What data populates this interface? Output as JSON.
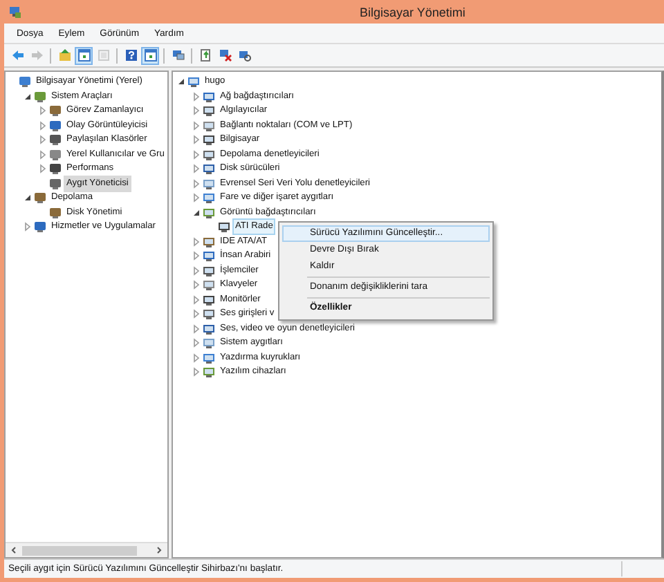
{
  "window": {
    "title": "Bilgisayar Yönetimi"
  },
  "menu": [
    "Dosya",
    "Eylem",
    "Görünüm",
    "Yardım"
  ],
  "toolbar": [
    {
      "kind": "back",
      "pressed": false,
      "disabled": false
    },
    {
      "kind": "forward",
      "pressed": false,
      "disabled": true
    },
    {
      "kind": "separator"
    },
    {
      "kind": "up",
      "pressed": false,
      "disabled": false
    },
    {
      "kind": "tree",
      "pressed": true,
      "disabled": false
    },
    {
      "kind": "export",
      "pressed": false,
      "disabled": true
    },
    {
      "kind": "separator"
    },
    {
      "kind": "help",
      "pressed": false,
      "disabled": false
    },
    {
      "kind": "pane",
      "pressed": true,
      "disabled": false
    },
    {
      "kind": "separator"
    },
    {
      "kind": "computer",
      "pressed": false,
      "disabled": false
    },
    {
      "kind": "separator"
    },
    {
      "kind": "update",
      "pressed": false,
      "disabled": false
    },
    {
      "kind": "uninstall",
      "pressed": false,
      "disabled": false
    },
    {
      "kind": "scan",
      "pressed": false,
      "disabled": false
    }
  ],
  "left_tree": [
    {
      "label": "Bilgisayar Yönetimi (Yerel)",
      "expandable": false,
      "selected": false,
      "children": [
        {
          "label": "Sistem Araçları",
          "expandable": true,
          "expanded": true,
          "selected": false,
          "children": [
            {
              "label": "Görev Zamanlayıcı",
              "expandable": true,
              "expanded": false,
              "selected": false
            },
            {
              "label": "Olay Görüntüleyicisi",
              "expandable": true,
              "expanded": false,
              "selected": false
            },
            {
              "label": "Paylaşılan Klasörler",
              "expandable": true,
              "expanded": false,
              "selected": false
            },
            {
              "label": "Yerel Kullanıcılar ve Gru",
              "expandable": true,
              "expanded": false,
              "selected": false
            },
            {
              "label": "Performans",
              "expandable": true,
              "expanded": false,
              "selected": false
            },
            {
              "label": "Aygıt Yöneticisi",
              "expandable": false,
              "selected": true
            }
          ]
        },
        {
          "label": "Depolama",
          "expandable": true,
          "expanded": true,
          "selected": false,
          "children": [
            {
              "label": "Disk Yönetimi",
              "expandable": false,
              "selected": false
            }
          ]
        },
        {
          "label": "Hizmetler ve Uygulamalar",
          "expandable": true,
          "expanded": false,
          "selected": false
        }
      ]
    }
  ],
  "right_tree": [
    {
      "label": "hugo",
      "expandable": true,
      "expanded": true,
      "selected": false,
      "children": [
        {
          "label": "Ağ bağdaştırıcıları",
          "expandable": true,
          "expanded": false,
          "selected": false
        },
        {
          "label": "Algılayıcılar",
          "expandable": true,
          "expanded": false,
          "selected": false
        },
        {
          "label": "Bağlantı noktaları (COM ve LPT)",
          "expandable": true,
          "expanded": false,
          "selected": false
        },
        {
          "label": "Bilgisayar",
          "expandable": true,
          "expanded": false,
          "selected": false
        },
        {
          "label": "Depolama denetleyicileri",
          "expandable": true,
          "expanded": false,
          "selected": false
        },
        {
          "label": "Disk sürücüleri",
          "expandable": true,
          "expanded": false,
          "selected": false
        },
        {
          "label": "Evrensel Seri Veri Yolu denetleyicileri",
          "expandable": true,
          "expanded": false,
          "selected": false
        },
        {
          "label": "Fare ve diğer işaret aygıtları",
          "expandable": true,
          "expanded": false,
          "selected": false
        },
        {
          "label": "Görüntü bağdaştırıcıları",
          "expandable": true,
          "expanded": true,
          "selected": false,
          "children": [
            {
              "label": "ATI Rade",
              "expandable": false,
              "selected": true
            }
          ]
        },
        {
          "label": "IDE ATA/AT",
          "expandable": true,
          "expanded": false,
          "selected": false
        },
        {
          "label": "İnsan Arabiri",
          "expandable": true,
          "expanded": false,
          "selected": false
        },
        {
          "label": "İşlemciler",
          "expandable": true,
          "expanded": false,
          "selected": false
        },
        {
          "label": "Klavyeler",
          "expandable": true,
          "expanded": false,
          "selected": false
        },
        {
          "label": "Monitörler",
          "expandable": true,
          "expanded": false,
          "selected": false
        },
        {
          "label": "Ses girişleri v",
          "expandable": true,
          "expanded": false,
          "selected": false
        },
        {
          "label": "Ses, video ve oyun denetleyicileri",
          "expandable": true,
          "expanded": false,
          "selected": false
        },
        {
          "label": "Sistem aygıtları",
          "expandable": true,
          "expanded": false,
          "selected": false
        },
        {
          "label": "Yazdırma kuyrukları",
          "expandable": true,
          "expanded": false,
          "selected": false
        },
        {
          "label": "Yazılım cihazları",
          "expandable": true,
          "expanded": false,
          "selected": false
        }
      ]
    }
  ],
  "context_menu": [
    {
      "kind": "item",
      "label": "Sürücü Yazılımını Güncelleştir...",
      "selected": true,
      "bold": false
    },
    {
      "kind": "item",
      "label": "Devre Dışı Bırak",
      "selected": false,
      "bold": false
    },
    {
      "kind": "item",
      "label": "Kaldır",
      "selected": false,
      "bold": false
    },
    {
      "kind": "separator"
    },
    {
      "kind": "item",
      "label": "Donanım değişikliklerini tara",
      "selected": false,
      "bold": false
    },
    {
      "kind": "separator"
    },
    {
      "kind": "item",
      "label": "Özellikler",
      "selected": false,
      "bold": true
    }
  ],
  "status_bar": {
    "text": "Seçili aygıt için Sürücü Yazılımını Güncelleştir Sihirbazı'nı başlatır."
  }
}
